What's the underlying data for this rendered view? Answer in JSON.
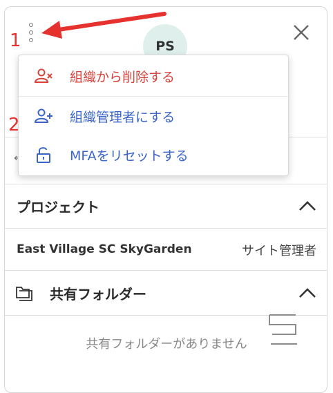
{
  "panel": {
    "avatar_initials": "PS",
    "colors": {
      "avatar_bg": "#dff0ec",
      "border": "#d6d6d6"
    }
  },
  "menu": {
    "items": [
      {
        "label": "組織から削除する",
        "icon": "remove-user-icon",
        "color": "#d5433c"
      },
      {
        "label": "組織管理者にする",
        "icon": "add-user-icon",
        "color": "#3a64c8"
      },
      {
        "label": "MFAをリセットする",
        "icon": "unlock-icon",
        "color": "#3a64c8"
      }
    ]
  },
  "projects": {
    "title": "プロジェクト",
    "rows": [
      {
        "name": "East Village SC SkyGarden",
        "role": "サイト管理者"
      }
    ]
  },
  "shared_folders": {
    "title": "共有フォルダー",
    "empty_message": "共有フォルダーがありません"
  },
  "annotations": {
    "step1": "1",
    "step2": "2",
    "arrow_color": "#e5322e"
  }
}
